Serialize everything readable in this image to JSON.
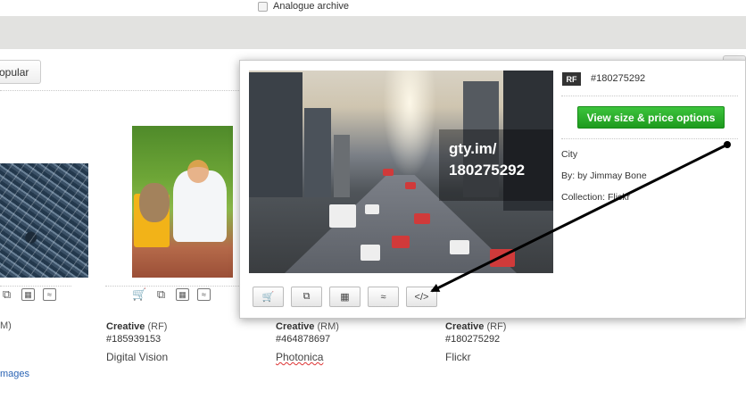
{
  "top": {
    "checkbox_label": "Analogue archive",
    "popular_label": "opular"
  },
  "gallery": {
    "left_stub_license": "M)",
    "more_images_link": "mages",
    "items": [
      {
        "collection": "Creative",
        "license": "(RF)",
        "id": "#185939153",
        "source": "Digital Vision"
      },
      {
        "collection": "Creative",
        "license": "(RM)",
        "id": "#464878697",
        "source": "Photonica"
      },
      {
        "collection": "Creative",
        "license": "(RF)",
        "id": "#180275292",
        "source": "Flickr"
      }
    ]
  },
  "popup": {
    "badge": "RF",
    "image_id": "#180275292",
    "price_button": "View size & price options",
    "title": "City",
    "by_line": "By: by Jimmay Bone",
    "collection_line": "Collection: Flickr",
    "watermark_line1": "gty.im/",
    "watermark_line2": "180275292",
    "tools": [
      "add-to-cart-icon",
      "compare-icon",
      "calculator-icon",
      "similar-icon",
      "embed-icon"
    ],
    "embed_glyph": "</>"
  },
  "colors": {
    "price_button": "#2ab02a",
    "band": "#e2e2e0",
    "arrow": "#000000"
  }
}
